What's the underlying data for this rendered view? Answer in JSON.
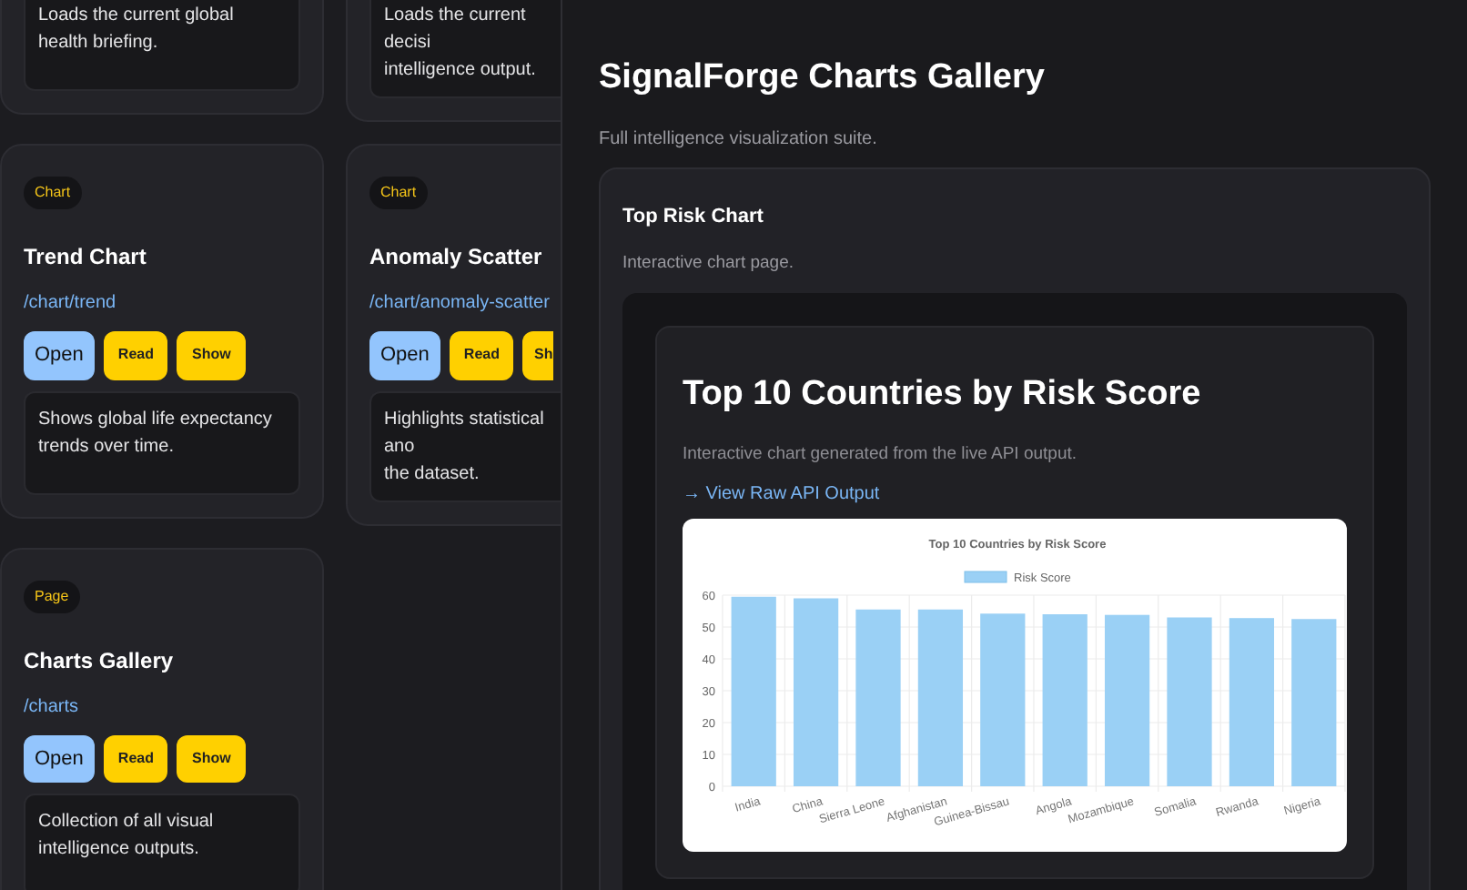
{
  "cards": [
    {
      "description_lines": [
        "Loads the current global health briefing."
      ]
    },
    {
      "description_lines": [
        "Loads the current decisi",
        "intelligence output."
      ]
    },
    {
      "badge": "Chart",
      "title": "Trend Chart",
      "path": "/chart/trend",
      "buttons": [
        {
          "label": "Open",
          "kind": "primary"
        },
        {
          "label": "Read",
          "kind": "secondary"
        },
        {
          "label": "Show",
          "kind": "secondary"
        }
      ],
      "description_lines": [
        "Shows global life expectancy trends over time."
      ]
    },
    {
      "badge": "Chart",
      "title": "Anomaly Scatter",
      "path": "/chart/anomaly-scatter",
      "buttons": [
        {
          "label": "Open",
          "kind": "primary"
        },
        {
          "label": "Read",
          "kind": "secondary"
        },
        {
          "label": "Sh",
          "kind": "cut"
        }
      ],
      "description_lines": [
        "Highlights statistical ano",
        "the dataset."
      ]
    },
    {
      "badge": "Page",
      "title": "Charts Gallery",
      "path": "/charts",
      "buttons": [
        {
          "label": "Open",
          "kind": "primary"
        },
        {
          "label": "Read",
          "kind": "secondary"
        },
        {
          "label": "Show",
          "kind": "secondary"
        }
      ],
      "description_lines": [
        "Collection of all visual intelligence outputs."
      ]
    }
  ],
  "panel": {
    "title": "SignalForge Charts Gallery",
    "subtitle": "Full intelligence visualization suite.",
    "section": {
      "title": "Top Risk Chart",
      "subtitle": "Interactive chart page.",
      "embed": {
        "title": "Top 10 Countries by Risk Score",
        "subtitle": "Interactive chart generated from the live API output.",
        "link": "→ View Raw API Output",
        "chart_data": {
          "type": "bar",
          "title": "Top 10 Countries by Risk Score",
          "categories": [
            "India",
            "China",
            "Sierra Leone",
            "Afghanistan",
            "Guinea-Bissau",
            "Angola",
            "Mozambique",
            "Somalia",
            "Rwanda",
            "Nigeria"
          ],
          "series": [
            {
              "name": "Risk Score",
              "color": "#9ad0f5",
              "values": [
                59.5,
                59,
                55.5,
                55.5,
                54.2,
                54,
                53.8,
                53,
                52.8,
                52.5
              ]
            }
          ],
          "grid": true,
          "ylim": [
            0,
            60
          ],
          "yticks": [
            0,
            10,
            20,
            30,
            40,
            50,
            60
          ]
        }
      }
    }
  }
}
